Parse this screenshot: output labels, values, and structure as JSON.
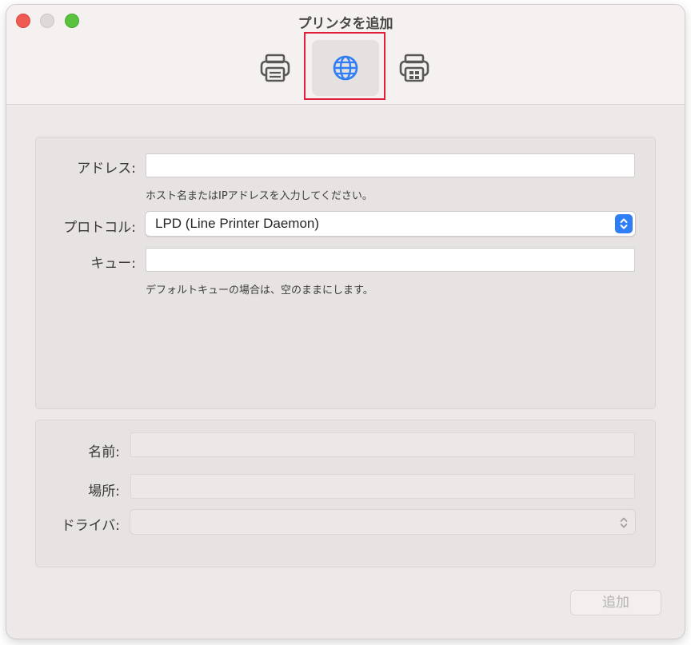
{
  "window": {
    "title": "プリンタを追加"
  },
  "toolbar": {
    "items": [
      {
        "name": "default",
        "icon": "printer-icon",
        "selected": false
      },
      {
        "name": "ip",
        "icon": "globe-icon",
        "selected": true
      },
      {
        "name": "windows",
        "icon": "windows-printer-icon",
        "selected": false
      }
    ]
  },
  "form": {
    "address_label": "アドレス:",
    "address_value": "",
    "address_hint": "ホスト名またはIPアドレスを入力してください。",
    "protocol_label": "プロトコル:",
    "protocol_value": "LPD (Line Printer Daemon)",
    "queue_label": "キュー:",
    "queue_value": "",
    "queue_hint": "デフォルトキューの場合は、空のままにします。"
  },
  "details": {
    "name_label": "名前:",
    "name_value": "",
    "location_label": "場所:",
    "location_value": "",
    "driver_label": "ドライバ:",
    "driver_value": ""
  },
  "footer": {
    "add_label": "追加"
  },
  "colors": {
    "accent": "#2f7ef6",
    "highlight": "#e0203a",
    "close": "#ef5a52",
    "maximize": "#59c23f"
  }
}
